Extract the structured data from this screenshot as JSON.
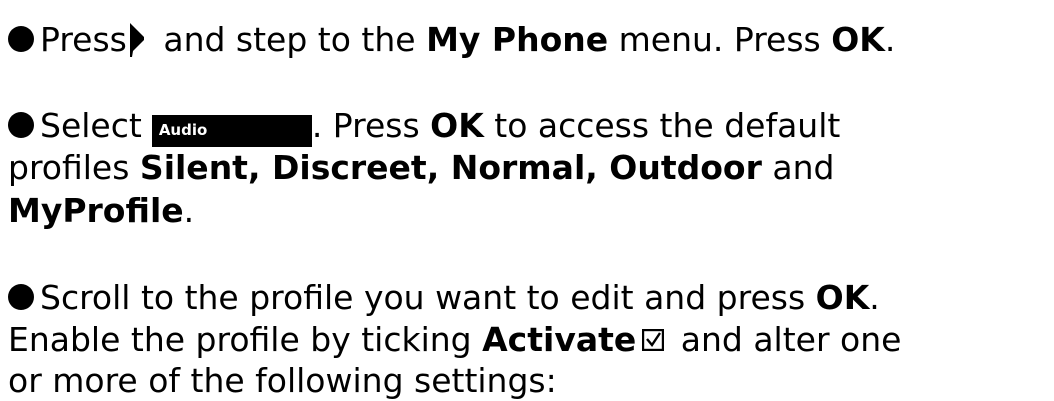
{
  "step1": {
    "press": "Press",
    "and_step": " and step to the ",
    "menu_name": "My Phone",
    "menu_suffix": " menu. Press ",
    "ok": "OK",
    "end": "."
  },
  "step2": {
    "select": "Select",
    "audio_label": "Audio",
    "press": ". Press ",
    "ok": "OK",
    "to_access": " to access the default",
    "profiles": "profiles ",
    "profile_list": "Silent, Discreet, Normal, Outdoor",
    "and": " and",
    "myprofile": "MyProfile",
    "end": "."
  },
  "step3": {
    "scroll": "Scroll to the profile you want to edit and press ",
    "ok": "OK",
    "end": ".",
    "enable": "Enable the profile by ticking ",
    "activate": "Activate",
    "alter": " and alter one",
    "settings": "or more of the following settings:"
  },
  "icons": {
    "arrow": "right-arrow-icon",
    "checkbox": "checked-box-icon"
  }
}
